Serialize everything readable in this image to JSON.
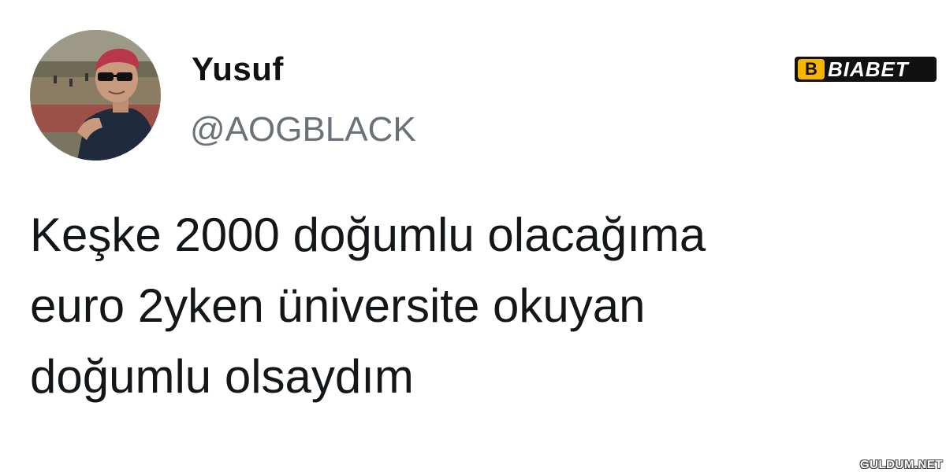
{
  "tweet": {
    "author": {
      "display_name": "Yusuf",
      "handle": "@AOGBLACK"
    },
    "text_lines": [
      "Keşke 2000 doğumlu olacağıma",
      "euro 2yken üniversite okuyan",
      "doğumlu olsaydım"
    ]
  },
  "brand": {
    "logo_text": "BIABET",
    "logo_mark": "B",
    "accent_color": "#f6b500"
  },
  "watermark": {
    "text": "GULDUM.NET"
  },
  "icons": {
    "avatar": "profile-photo"
  }
}
